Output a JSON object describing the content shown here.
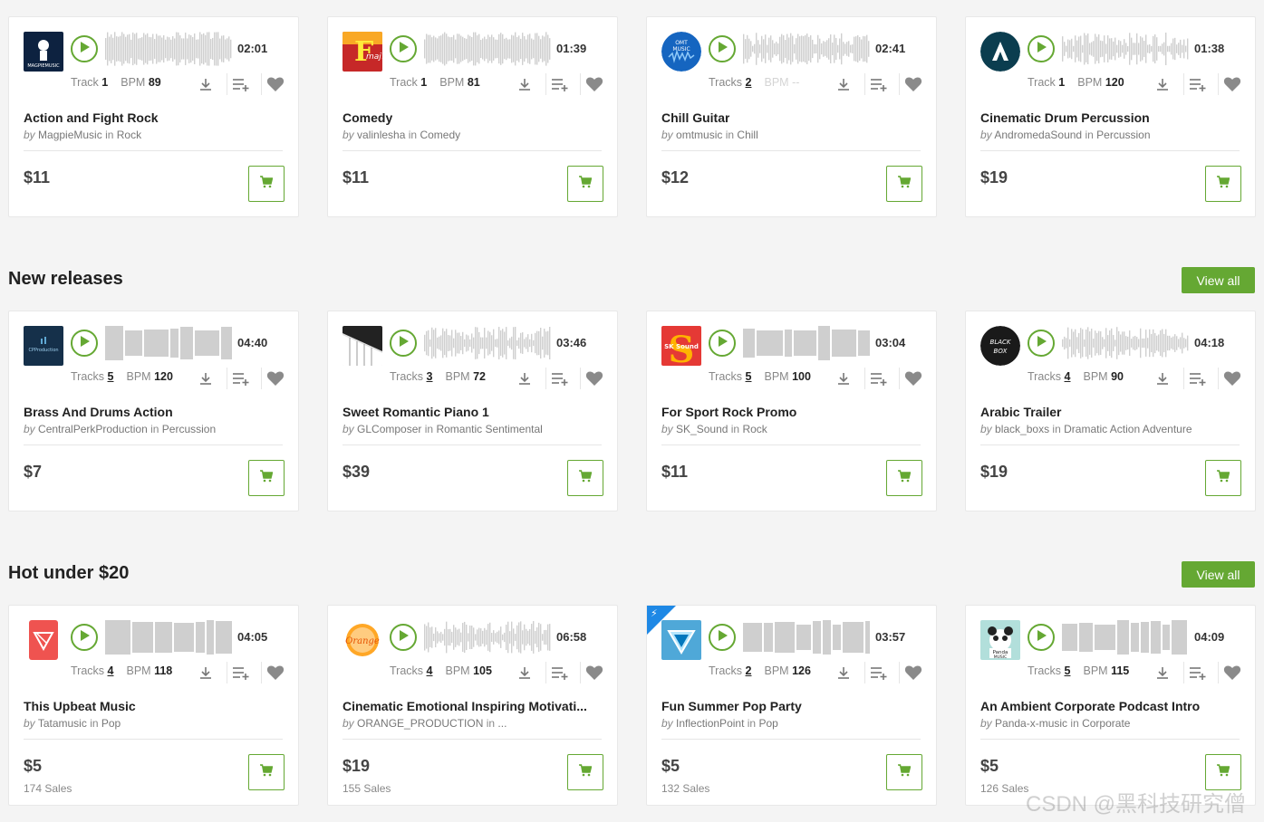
{
  "colors": {
    "accent": "#65a833",
    "wave": "#cfcfcf"
  },
  "labels": {
    "by": "by",
    "in": "in",
    "bpm": "BPM"
  },
  "sections": [
    {
      "title": "",
      "view_all": "",
      "cards": [
        {
          "thumb": "magpie",
          "thumb_text": "MAGPIEMUSIC",
          "duration": "02:01",
          "tracks_label": "Track",
          "tracks": "1",
          "bpm": "89",
          "title": "Action and Fight Rock",
          "author": "MagpieMusic",
          "category": "Rock",
          "price": "$11",
          "sales": ""
        },
        {
          "thumb": "comedy",
          "thumb_text": "F",
          "duration": "01:39",
          "tracks_label": "Track",
          "tracks": "1",
          "bpm": "81",
          "title": "Comedy",
          "author": "valinlesha",
          "category": "Comedy",
          "price": "$11",
          "sales": ""
        },
        {
          "thumb": "omt",
          "thumb_text": "OMT MUSIC",
          "duration": "02:41",
          "tracks_label": "Tracks",
          "tracks": "2",
          "bpm": "--",
          "title": "Chill Guitar",
          "author": "omtmusic",
          "category": "Chill",
          "price": "$12",
          "sales": ""
        },
        {
          "thumb": "andromeda",
          "thumb_text": "A",
          "duration": "01:38",
          "tracks_label": "Track",
          "tracks": "1",
          "bpm": "120",
          "title": "Cinematic Drum Percussion",
          "author": "AndromedaSound",
          "category": "Percussion",
          "price": "$19",
          "sales": ""
        }
      ]
    },
    {
      "title": "New releases",
      "view_all": "View all",
      "cards": [
        {
          "thumb": "central",
          "thumb_text": "CPProduction",
          "duration": "04:40",
          "tracks_label": "Tracks",
          "tracks": "5",
          "bpm": "120",
          "title": "Brass And Drums Action",
          "author": "CentralPerkProduction",
          "category": "Percussion",
          "price": "$7",
          "sales": ""
        },
        {
          "thumb": "piano",
          "thumb_text": "",
          "duration": "03:46",
          "tracks_label": "Tracks",
          "tracks": "3",
          "bpm": "72",
          "title": "Sweet Romantic Piano 1",
          "author": "GLComposer",
          "category": "Romantic Sentimental",
          "price": "$39",
          "sales": ""
        },
        {
          "thumb": "sksound",
          "thumb_text": "SK Sound",
          "duration": "03:04",
          "tracks_label": "Tracks",
          "tracks": "5",
          "bpm": "100",
          "title": "For Sport Rock Promo",
          "author": "SK_Sound",
          "category": "Rock",
          "price": "$11",
          "sales": ""
        },
        {
          "thumb": "blackbox",
          "thumb_text": "BLACK BOX",
          "duration": "04:18",
          "tracks_label": "Tracks",
          "tracks": "4",
          "bpm": "90",
          "title": "Arabic Trailer",
          "author": "black_boxs",
          "category": "Dramatic Action Adventure",
          "price": "$19",
          "sales": ""
        }
      ]
    },
    {
      "title": "Hot under $20",
      "view_all": "View all",
      "cards": [
        {
          "thumb": "tatamusic",
          "thumb_text": "",
          "duration": "04:05",
          "tracks_label": "Tracks",
          "tracks": "4",
          "bpm": "118",
          "title": "This Upbeat Music",
          "author": "Tatamusic",
          "category": "Pop",
          "price": "$5",
          "sales": "174 Sales"
        },
        {
          "thumb": "orange",
          "thumb_text": "Orange",
          "duration": "06:58",
          "tracks_label": "Tracks",
          "tracks": "4",
          "bpm": "105",
          "title": "Cinematic Emotional Inspiring Motivati...",
          "author": "ORANGE_PRODUCTION",
          "category": "...",
          "price": "$19",
          "sales": "155 Sales"
        },
        {
          "thumb": "inflection",
          "thumb_text": "",
          "duration": "03:57",
          "tracks_label": "Tracks",
          "tracks": "2",
          "bpm": "126",
          "title": "Fun Summer Pop Party",
          "author": "InflectionPoint",
          "category": "Pop",
          "price": "$5",
          "sales": "132 Sales"
        },
        {
          "thumb": "panda",
          "thumb_text": "Panda MUSIC",
          "duration": "04:09",
          "tracks_label": "Tracks",
          "tracks": "5",
          "bpm": "115",
          "title": "An Ambient Corporate Podcast Intro",
          "author": "Panda-x-music",
          "category": "Corporate",
          "price": "$5",
          "sales": "126 Sales"
        }
      ]
    }
  ],
  "watermark": "CSDN @黑科技研究僧"
}
